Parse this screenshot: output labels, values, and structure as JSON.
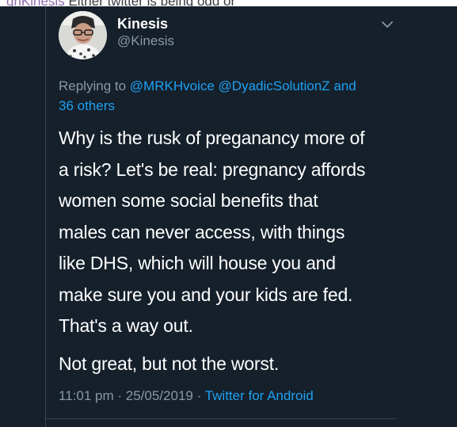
{
  "top_strip": {
    "left_text": "gnKinesis",
    "right_text": "Either twitter is being odd or"
  },
  "tweet": {
    "display_name": "Kinesis",
    "handle": "@Kinesis",
    "replying_prefix": "Replying to",
    "mention_1": "@MRKHvoice",
    "mention_2": "@DyadicSolutionZ",
    "mention_and": "and",
    "mention_others": "36 others",
    "body_lines": [
      "Why is the rusk of preganancy more of",
      "a risk? Let's be real: pregnancy affords",
      "women some social benefits that",
      "males can never access, with things",
      "like DHS, which will house you and",
      "make sure you and your kids are fed.",
      "That's a way out."
    ],
    "body_para2": "Not great, but not the worst.",
    "time": "11:01 pm",
    "separator": "·",
    "date": "25/05/2019",
    "source": "Twitter for Android"
  },
  "icons": {
    "avatar": "avatar-photo",
    "chevron": "chevron-down-icon"
  },
  "colors": {
    "background": "#15202b",
    "text_primary": "#ffffff",
    "text_secondary": "#8899a6",
    "accent": "#1da1f2",
    "border": "#38444d"
  }
}
